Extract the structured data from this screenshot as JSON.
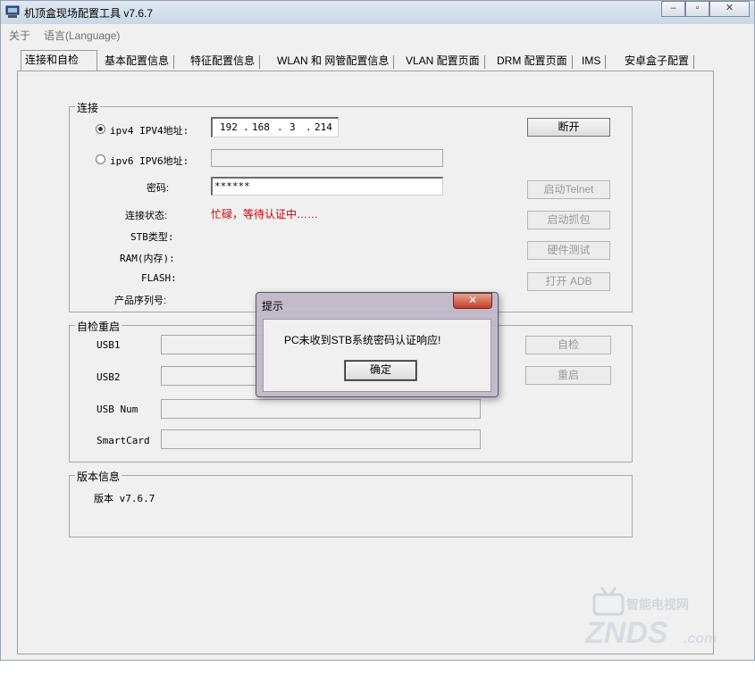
{
  "window": {
    "title": "机顶盒现场配置工具 v7.6.7"
  },
  "menu": {
    "about": "关于",
    "language": "语言(Language)"
  },
  "tabs": [
    "连接和自检",
    "基本配置信息",
    "特征配置信息",
    "WLAN 和 网管配置信息",
    "VLAN 配置页面",
    "DRM 配置页面",
    "IMS",
    "安卓盒子配置"
  ],
  "connection": {
    "title": "连接",
    "ipv4_label": "ipv4  IPV4地址:",
    "ipv4_octets": [
      "192",
      "168",
      "3",
      "214"
    ],
    "ipv6_label": "ipv6  IPV6地址:",
    "ipv6_value": "",
    "password_label": "密码:",
    "password_value": "******",
    "status_label": "连接状态:",
    "status_value": "忙碌，等待认证中……",
    "stb_type_label": "STB类型:",
    "ram_label": "RAM(内存):",
    "flash_label": "FLASH:",
    "serial_label": "产品序列号:",
    "buttons": {
      "disconnect": "断开",
      "telnet": "启动Telnet",
      "capture": "启动抓包",
      "hwtest": "硬件测试",
      "adb": "打开 ADB"
    }
  },
  "selftest": {
    "title": "自检重启",
    "usb1": "USB1",
    "usb2": "USB2",
    "usbnum": "USB Num",
    "smartcard": "SmartCard",
    "selftest_button": "自检",
    "reboot_button": "重启"
  },
  "version": {
    "title": "版本信息",
    "text": "版本 v7.6.7"
  },
  "dialog": {
    "title": "提示",
    "message": "PC未收到STB系统密码认证响应!",
    "ok": "确定"
  },
  "watermark": {
    "brand": "ZNDS",
    "tagline": "智能电视网",
    "suffix": ".com"
  },
  "colors": {
    "status_red": "#cc0000",
    "panel_bg": "#f0f0f0"
  }
}
